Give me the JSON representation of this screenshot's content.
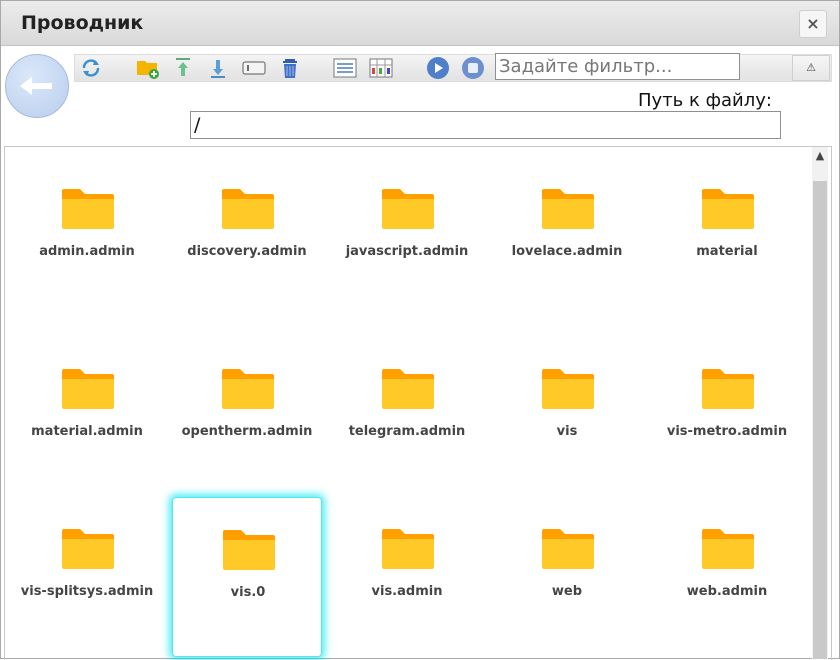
{
  "window": {
    "title": "Проводник",
    "close_label": "×"
  },
  "toolbar": {
    "buttons": [
      "refresh-icon",
      "new-folder-icon",
      "upload-icon",
      "download-icon",
      "rename-icon",
      "delete-icon",
      "list-view-icon",
      "table-view-icon",
      "play-icon",
      "stop-icon"
    ],
    "filter_placeholder": "Задайте фильтр...",
    "warn_label": "⚠"
  },
  "path": {
    "label": "Путь к файлу:",
    "value": "/"
  },
  "colors": {
    "folder": "#FFCA28",
    "folder_tab": "#FFA000",
    "selection_glow": "#00E6F0"
  },
  "files": [
    {
      "name": "admin.admin"
    },
    {
      "name": "discovery.admin"
    },
    {
      "name": "javascript.admin"
    },
    {
      "name": "lovelace.admin"
    },
    {
      "name": "material"
    },
    {
      "name": "material.admin"
    },
    {
      "name": "opentherm.admin"
    },
    {
      "name": "telegram.admin"
    },
    {
      "name": "vis"
    },
    {
      "name": "vis-metro.admin"
    },
    {
      "name": "vis-splitsys.admin"
    },
    {
      "name": "vis.0",
      "selected": true
    },
    {
      "name": "vis.admin"
    },
    {
      "name": "web"
    },
    {
      "name": "web.admin"
    }
  ]
}
